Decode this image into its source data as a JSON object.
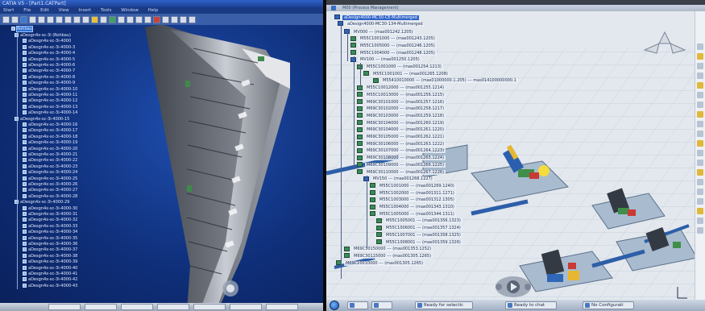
{
  "left_window": {
    "title": "CATIA V5 - [Part1.CATPart]",
    "menu": [
      "Start",
      "File",
      "Edit",
      "View",
      "Insert",
      "Tools",
      "Window",
      "Help"
    ],
    "tree_root": "Rohbau",
    "tree_items": [
      "aDesgn4x-sc-3i (Rohbau)",
      "aDesgn4x-sc-3i-4000",
      "aDesgn4x-sc-3i-4000-3",
      "aDesgn4x-sc-3i-4000-4",
      "aDesgn4x-sc-3i-4000-5",
      "aDesgn4x-sc-3i-4000-6",
      "aDesgn4x-sc-3i-4000-7",
      "aDesgn4x-sc-3i-4000-8",
      "aDesgn4x-sc-3i-4000-9",
      "aDesgn4x-sc-3i-4000-10",
      "aDesgn4x-sc-3i-4000-11",
      "aDesgn4x-sc-3i-4000-12",
      "aDesgn4x-sc-3i-4000-13",
      "aDesgn4x-sc-3i-4000-14",
      "aDesgn4x-sc-3i-4000-15",
      "aDesgn4x-sc-3i-4000-16",
      "aDesgn4x-sc-3i-4000-17",
      "aDesgn4x-sc-3i-4000-18",
      "aDesgn4x-sc-3i-4000-19",
      "aDesgn4x-sc-3i-4000-20",
      "aDesgn4x-sc-3i-4000-21",
      "aDesgn4x-sc-3i-4000-22",
      "aDesgn4x-sc-3i-4000-23",
      "aDesgn4x-sc-3i-4000-24",
      "aDesgn4x-sc-3i-4000-25",
      "aDesgn4x-sc-3i-4000-26",
      "aDesgn4x-sc-3i-4000-27",
      "aDesgn4x-sc-3i-4000-28",
      "aDesgn4x-sc-3i-4000-29",
      "aDesgn4x-sc-3i-4000-30",
      "aDesgn4x-sc-3i-4000-31",
      "aDesgn4x-sc-3i-4000-32",
      "aDesgn4x-sc-3i-4000-33",
      "aDesgn4x-sc-3i-4000-34",
      "aDesgn4x-sc-3i-4000-35",
      "aDesgn4x-sc-3i-4000-36",
      "aDesgn4x-sc-3i-4000-37",
      "aDesgn4x-sc-3i-4000-38",
      "aDesgn4x-sc-3i-4000-39",
      "aDesgn4x-sc-3i-4000-40",
      "aDesgn4x-sc-3i-4000-41",
      "aDesgn4x-sc-3i-4000-42",
      "aDesgn4x-sc-3i-4000-43"
    ]
  },
  "right_window": {
    "title": "M00 (Process Management)",
    "root": "aDesign4000-MC30-CE-Multimerged",
    "root2": "aDesign4000-MC30-134-Multimerged",
    "tree_items": [
      "MV000 --- (mas001242.1205)",
      "M55C1001000 --- (mas001243.1205)",
      "M55C1005000 --- (mas001246.1205)",
      "M55C1004000 --- (mas001248.1205)",
      "MV100 --- (mas001250.1205)",
      "M55C1001000 --- (mas001254.1213)",
      "M55C1001001 --- (mas001265.1208)",
      "M55410010000 --- (mas01000000.1.205) --- mas014100000000.1",
      "M55C10012000 --- (mas001255.1214)",
      "M55C10013000 --- (mas001256.1215)",
      "M69C30101000 --- (mas001257.1216)",
      "M69C30102000 --- (mas001258.1217)",
      "M69C30103000 --- (mas001259.1218)",
      "M69C30104000 --- (mas001260.1219)",
      "M69C30104000 --- (mas001261.1220)",
      "M69C30105000 --- (mas001262.1221)",
      "M69C30106000 --- (mas001263.1222)",
      "M69C30107000 --- (mas001264.1223)",
      "M69C30108000 --- (mas001265.1224)",
      "M69C30109000 --- (mas001266.1225)",
      "M69C30110000 --- (mas001267.1226)",
      "MV150 --- (mas001268.1227)",
      "M55C1001000 --- (mas001269.1240)",
      "M55C1002000 --- (mas001311.1271)",
      "M55C1003000 --- (mas001312.1305)",
      "M55C1004000 --- (mas001343.1310)",
      "M55C1005000 --- (mas001344.1311)",
      "M55C1005001 --- (mas001356.1323)",
      "M55C1006001 --- (mas001357.1324)",
      "M55C1007001 --- (mas001358.1325)",
      "M55C1008001 --- (mas001359.1326)",
      "M69C30150000 --- (mas001353.1252)",
      "M69C30115000 --- (mas001305.1265)",
      "M69C10010000 --- (mas001305.1265)"
    ],
    "taskbar": {
      "items": [
        "Ready for selectic",
        "Ready to chat",
        "No Configurati"
      ]
    }
  }
}
